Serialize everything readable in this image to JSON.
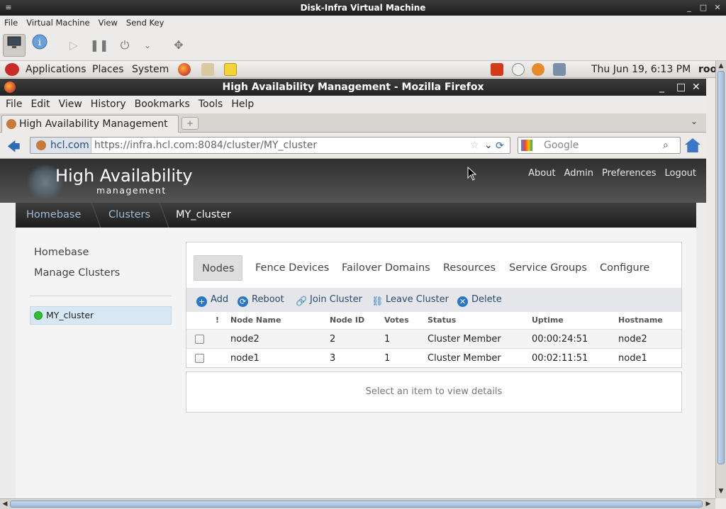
{
  "vm": {
    "title": "Disk-Infra Virtual Machine",
    "menu": [
      "File",
      "Virtual Machine",
      "View",
      "Send Key"
    ]
  },
  "gnome": {
    "menus": [
      "Applications",
      "Places",
      "System"
    ],
    "clock": "Thu Jun 19,  6:13 PM",
    "user_truncated": "roo"
  },
  "firefox": {
    "title": "High Availability Management - Mozilla Firefox",
    "menu": [
      "File",
      "Edit",
      "View",
      "History",
      "Bookmarks",
      "Tools",
      "Help"
    ],
    "tab_title": "High Availability Management",
    "site_identity": "hcl.com",
    "url": "https://infra.hcl.com:8084/cluster/MY_cluster",
    "search_placeholder": "Google"
  },
  "app": {
    "logo_title": "High Availability",
    "logo_subtitle": "management",
    "top_links": [
      "About",
      "Admin",
      "Preferences",
      "Logout"
    ],
    "breadcrumbs": [
      "Homebase",
      "Clusters",
      "MY_cluster"
    ],
    "sidebar": [
      "Homebase",
      "Manage Clusters"
    ],
    "cluster_name": "MY_cluster",
    "cluster_status_color": "#2fbf2f",
    "tabs": [
      "Nodes",
      "Fence Devices",
      "Failover Domains",
      "Resources",
      "Service Groups",
      "Configure"
    ],
    "active_tab": "Nodes",
    "actions": [
      {
        "label": "Add",
        "icon": "add-icon",
        "color": "#2a76c6"
      },
      {
        "label": "Reboot",
        "icon": "reboot-icon",
        "color": "#2a76c6"
      },
      {
        "label": "Join Cluster",
        "icon": "join-icon",
        "color": "#2a76c6"
      },
      {
        "label": "Leave Cluster",
        "icon": "leave-icon",
        "color": "#2a76c6"
      },
      {
        "label": "Delete",
        "icon": "delete-icon",
        "color": "#2a76c6"
      }
    ],
    "columns": [
      "!",
      "Node Name",
      "Node ID",
      "Votes",
      "Status",
      "Uptime",
      "Hostname"
    ],
    "rows": [
      {
        "name": "node2",
        "id": "2",
        "votes": "1",
        "status": "Cluster Member",
        "uptime": "00:00:24:51",
        "hostname": "node2"
      },
      {
        "name": "node1",
        "id": "3",
        "votes": "1",
        "status": "Cluster Member",
        "uptime": "00:02:11:51",
        "hostname": "node1"
      }
    ],
    "details_placeholder": "Select an item to view details"
  }
}
